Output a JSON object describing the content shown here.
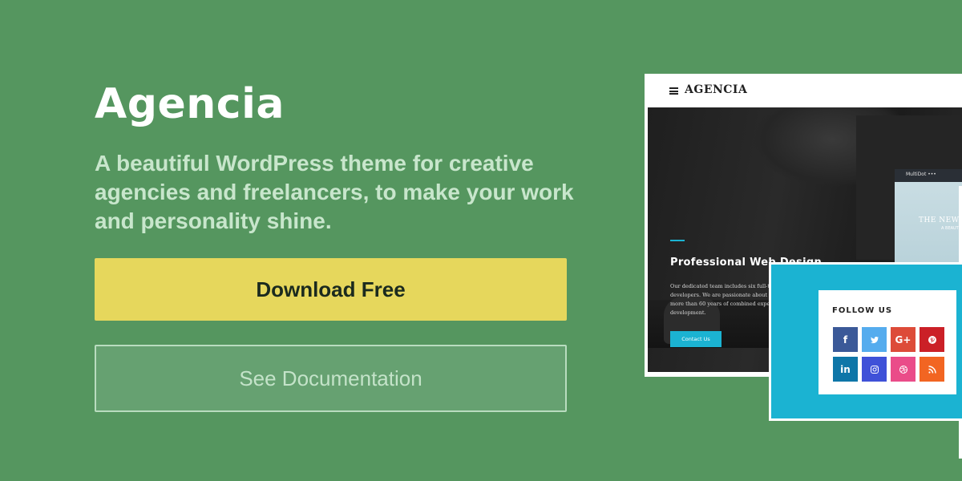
{
  "hero": {
    "title": "Agencia",
    "tagline": "A beautiful WordPress theme for creative agencies and freelancers, to make your work and personality shine.",
    "download_label": "Download Free",
    "docs_label": "See Documentation"
  },
  "preview": {
    "brand": "AGENCIA",
    "menu_icon": "hamburger-menu-icon",
    "heading": "Professional Web Design",
    "body": "Our dedicated team includes six full-time marketing experts and website developers. We are passionate about website development, and our staff has more than 60 years of combined experience in website design and website development.",
    "cta_label": "Contact Us",
    "side_bar_label": "MultiDot •••",
    "side_headline": "THE NEW",
    "side_subline": "A BEAUT",
    "follow_title": "FOLLOW US",
    "social": [
      {
        "name": "facebook",
        "glyph": "f",
        "color": "#3b5998"
      },
      {
        "name": "twitter",
        "glyph": "t",
        "color": "#55acee"
      },
      {
        "name": "google-plus",
        "glyph": "G+",
        "color": "#dd4b39"
      },
      {
        "name": "pinterest",
        "glyph": "p",
        "color": "#cb2027"
      },
      {
        "name": "linkedin",
        "glyph": "in",
        "color": "#0e76a8"
      },
      {
        "name": "instagram",
        "glyph": "ig",
        "color": "#3f51d8"
      },
      {
        "name": "dribbble",
        "glyph": "dr",
        "color": "#ea4c89"
      },
      {
        "name": "rss",
        "glyph": "rss",
        "color": "#f26522"
      }
    ]
  },
  "colors": {
    "background": "#55965f",
    "download_button": "#e6d75c",
    "accent": "#1bb3d2"
  }
}
